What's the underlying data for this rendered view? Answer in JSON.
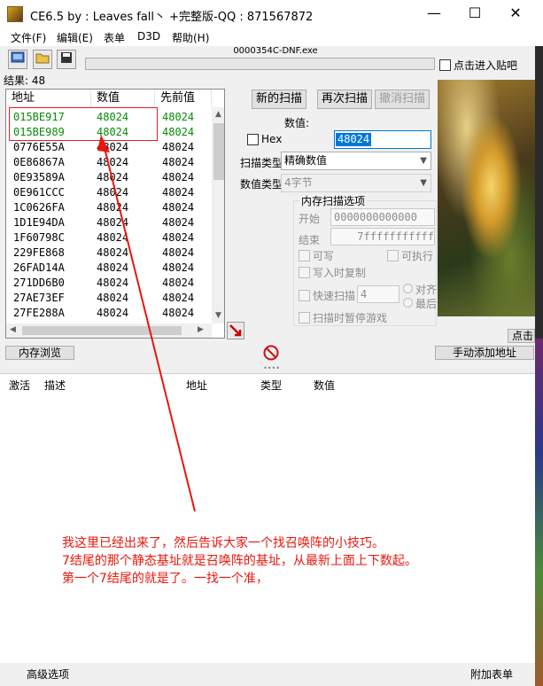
{
  "window": {
    "title": "CE6.5 by : Leaves fall丶 +完整版-QQ : 871567872",
    "minimize": "—",
    "maximize": "☐",
    "close": "✕"
  },
  "menu": [
    "文件(F)",
    "编辑(E)",
    "表单",
    "D3D",
    "帮助(H)"
  ],
  "toolbar": {
    "process_name": "0000354C-DNF.exe",
    "progress_percent": 0,
    "pin_label": "点击进入贴吧"
  },
  "results": {
    "count_label": "结果:  48",
    "headers": [
      "地址",
      "数值",
      "先前值"
    ],
    "rows": [
      [
        "015BE917",
        "48024",
        "48024"
      ],
      [
        "015BE989",
        "48024",
        "48024"
      ],
      [
        "0776E55A",
        "48024",
        "48024"
      ],
      [
        "0E86867A",
        "48024",
        "48024"
      ],
      [
        "0E93589A",
        "48024",
        "48024"
      ],
      [
        "0E961CCC",
        "48024",
        "48024"
      ],
      [
        "1C0626FA",
        "48024",
        "48024"
      ],
      [
        "1D1E94DA",
        "48024",
        "48024"
      ],
      [
        "1F60798C",
        "48024",
        "48024"
      ],
      [
        "229FE868",
        "48024",
        "48024"
      ],
      [
        "26FAD14A",
        "48024",
        "48024"
      ],
      [
        "271DD6B0",
        "48024",
        "48024"
      ],
      [
        "27AE73EF",
        "48024",
        "48024"
      ],
      [
        "27FE288A",
        "48024",
        "48024"
      ]
    ]
  },
  "scan": {
    "new_scan": "新的扫描",
    "next_scan": "再次扫描",
    "undo_scan": "撤消扫描",
    "value_label": "数值:",
    "hex_label": "Hex",
    "value": "48024",
    "scan_type_label": "扫描类型",
    "scan_type_value": "精确数值",
    "value_type_label": "数值类型",
    "value_type_value": "4字节",
    "memory_options_title": "内存扫描选项",
    "start_label": "开始",
    "start_value": "0000000000000",
    "stop_label": "结束",
    "stop_value": "7fffffffffff",
    "writable_label": "可写",
    "executable_label": "可执行",
    "copy_on_write_label": "写入时复制",
    "fast_scan_label": "快速扫描",
    "fast_scan_value": "4",
    "align_label": "对齐",
    "last_digits_label": "最后",
    "pause_label": "扫描时暂停游戏"
  },
  "lower": {
    "memory_view": "内存浏览",
    "add_manual": "手动添加地址",
    "right_partial": "点击",
    "columns": [
      "激活",
      "描述",
      "地址",
      "类型",
      "数值"
    ]
  },
  "annotation": [
    "我这里已经出来了，然后告诉大家一个找召唤阵的小技巧。",
    "7结尾的那个静态基址就是召唤阵的基址，从最新上面上下数起。",
    "第一个7结尾的就是了。一找一个准，"
  ],
  "status": {
    "advanced": "高级选项",
    "table_extras": "附加表单"
  },
  "colors": {
    "annotation_red": "#e8170c",
    "static_green": "#0a8a0a",
    "selection_blue": "#0078d7"
  }
}
